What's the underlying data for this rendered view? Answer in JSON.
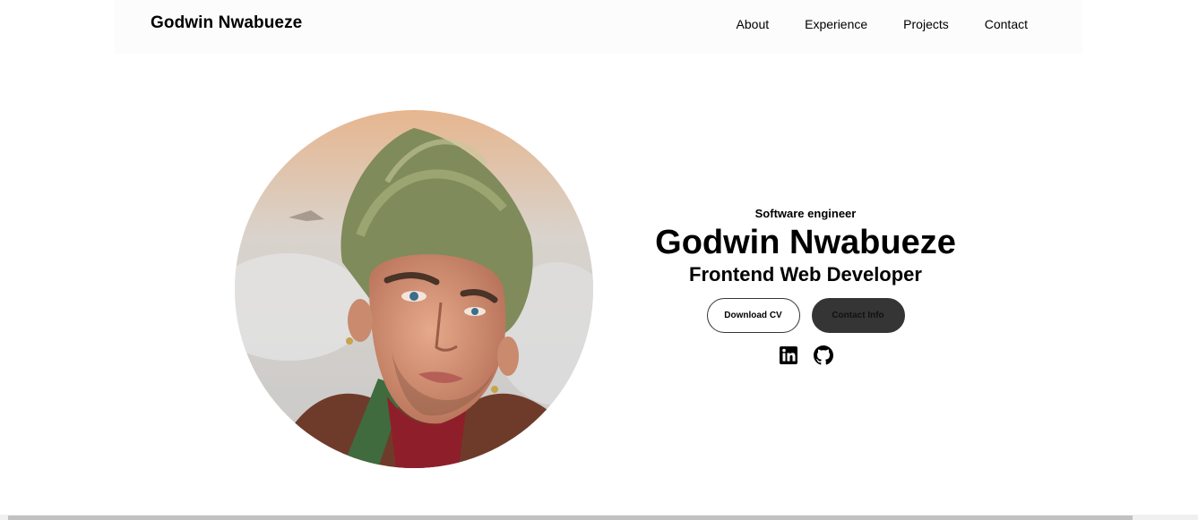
{
  "nav": {
    "logo": "Godwin Nwabueze",
    "links": [
      "About",
      "Experience",
      "Projects",
      "Contact"
    ]
  },
  "hero": {
    "subtitle": "Software engineer",
    "name": "Godwin Nwabueze",
    "role": "Frontend Web Developer",
    "download_label": "Download CV",
    "contact_label": "Contact Info"
  },
  "socials": {
    "icons": [
      "linkedin-icon",
      "github-icon"
    ]
  },
  "colors": {
    "button_dark": "#353535",
    "nav_bg": "#fcfcfc"
  }
}
